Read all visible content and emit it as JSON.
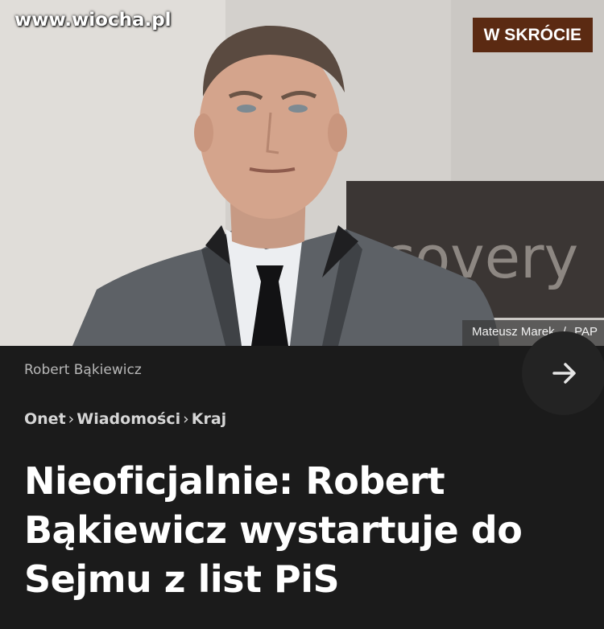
{
  "watermark": "www.wiocha.pl",
  "badge": "W SKRÓCIE",
  "photo": {
    "credit_author": "Mateusz Marek",
    "credit_separator": "/",
    "credit_agency": "PAP",
    "sign_text": "scovery"
  },
  "author": {
    "name": "Robert Bąkiewicz"
  },
  "breadcrumb": {
    "items": [
      "Onet",
      "Wiadomości",
      "Kraj"
    ],
    "separator": "›"
  },
  "headline": "Nieoficjalnie: Robert Bąkiewicz wystartuje do Sejmu z list PiS",
  "icons": {
    "next": "chevron-right-icon"
  }
}
